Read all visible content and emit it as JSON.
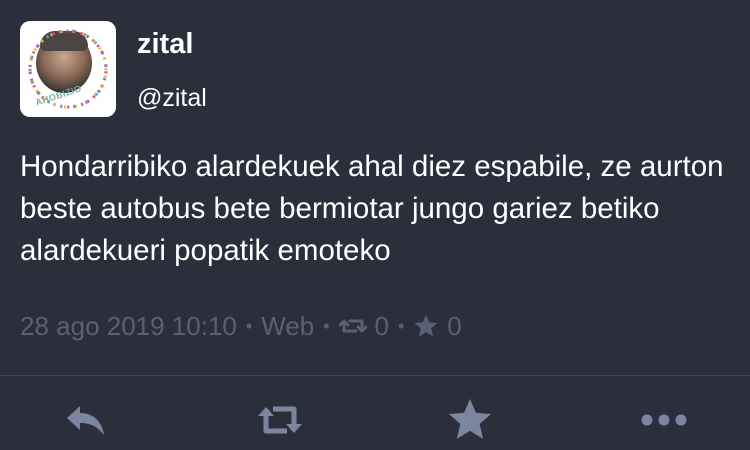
{
  "user": {
    "display_name": "zital",
    "handle": "@zital",
    "avatar_ring_text": "AHOBIZIO"
  },
  "tweet": {
    "text": "Hondarribiko alardekuek ahal diez espabile, ze aurton beste autobus bete bermiotar jungo gariez betiko alardekueri popatik emoteko",
    "timestamp": "28 ago 2019 10:10",
    "source": "Web",
    "retweet_count": "0",
    "favorite_count": "0"
  },
  "actions": {
    "reply_icon": "reply-icon",
    "retweet_icon": "retweet-icon",
    "favorite_icon": "star-icon",
    "more_icon": "more-icon"
  },
  "colors": {
    "background": "#2b2e3b",
    "text": "#ffffff",
    "meta": "#5a6175",
    "action_icon": "#7c869f",
    "divider": "#3f4352"
  }
}
